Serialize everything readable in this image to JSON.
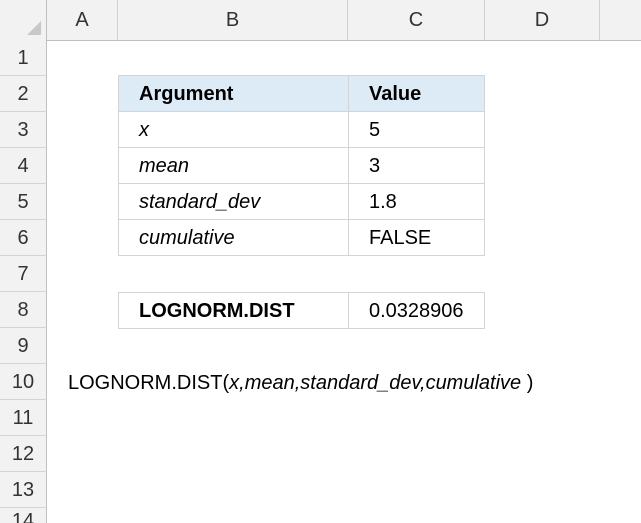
{
  "columns": [
    "A",
    "B",
    "C",
    "D"
  ],
  "rows": [
    "1",
    "2",
    "3",
    "4",
    "5",
    "6",
    "7",
    "8",
    "9",
    "10",
    "11",
    "12",
    "13",
    "14"
  ],
  "table": {
    "header": {
      "argument": "Argument",
      "value": "Value"
    },
    "rows": [
      {
        "argument": "x",
        "value": "5"
      },
      {
        "argument": "mean",
        "value": "3"
      },
      {
        "argument": "standard_dev",
        "value": "1.8"
      },
      {
        "argument": "cumulative",
        "value": "FALSE"
      }
    ]
  },
  "result": {
    "label": "LOGNORM.DIST",
    "value": "0.0328906"
  },
  "syntax": {
    "fn": "LOGNORM.DIST(",
    "a1": "x",
    "c1": ",",
    "a2": "mean",
    "c2": ",",
    "a3": "standard_dev",
    "c3": ",",
    "a4": "cumulative",
    "close": " )"
  }
}
